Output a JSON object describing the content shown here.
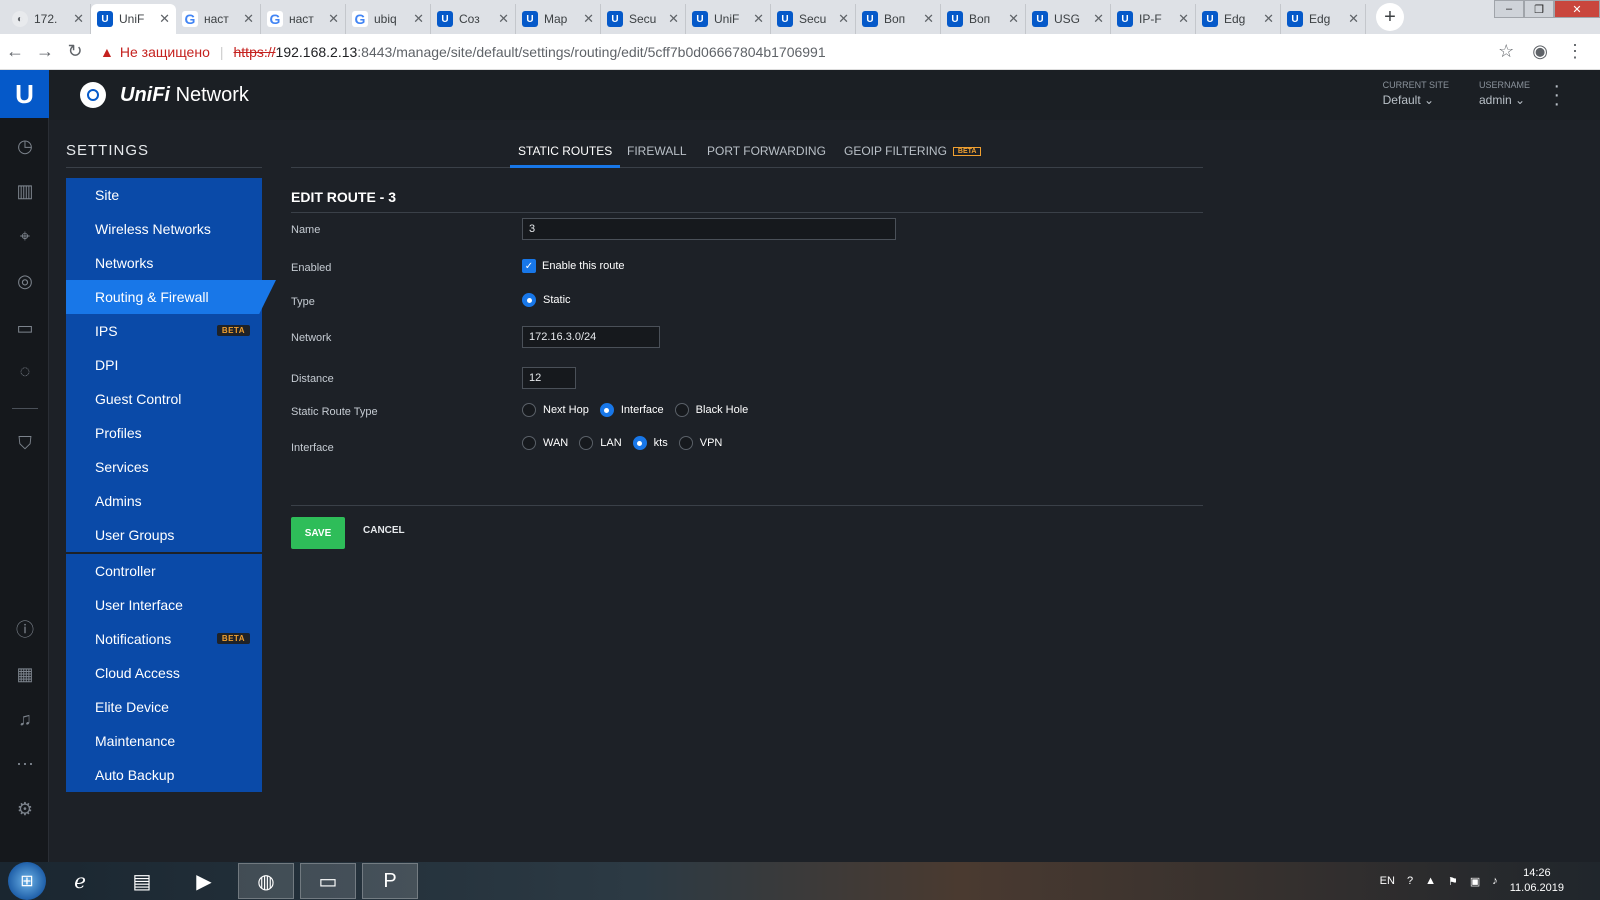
{
  "browser": {
    "tabs": [
      {
        "title": "172.",
        "icon": "w"
      },
      {
        "title": "UniF",
        "icon": "u",
        "active": true
      },
      {
        "title": "наст",
        "icon": "g"
      },
      {
        "title": "наст",
        "icon": "g"
      },
      {
        "title": "ubiq",
        "icon": "g"
      },
      {
        "title": "Соз",
        "icon": "u"
      },
      {
        "title": "Map",
        "icon": "u"
      },
      {
        "title": "Secu",
        "icon": "u"
      },
      {
        "title": "UniF",
        "icon": "u"
      },
      {
        "title": "Secu",
        "icon": "u"
      },
      {
        "title": "Воп",
        "icon": "u"
      },
      {
        "title": "Воп",
        "icon": "u"
      },
      {
        "title": "USG",
        "icon": "u"
      },
      {
        "title": "IP-F",
        "icon": "u"
      },
      {
        "title": "Edg",
        "icon": "u"
      },
      {
        "title": "Edg",
        "icon": "u"
      }
    ],
    "insecure_label": "Не защищено",
    "url_scheme": "https://",
    "url_host": "192.168.2.13",
    "url_path": ":8443/manage/site/default/settings/routing/edit/5cff7b0d06667804b1706991"
  },
  "header": {
    "brand_unifi": "UniFi",
    "brand_network": "Network",
    "current_site_label": "CURRENT SITE",
    "current_site_value": "Default",
    "username_label": "USERNAME",
    "username_value": "admin"
  },
  "sidebar": {
    "title": "SETTINGS",
    "group1": [
      {
        "label": "Site"
      },
      {
        "label": "Wireless Networks"
      },
      {
        "label": "Networks"
      },
      {
        "label": "Routing & Firewall",
        "active": true
      },
      {
        "label": "IPS",
        "badge": "BETA"
      },
      {
        "label": "DPI"
      },
      {
        "label": "Guest Control"
      },
      {
        "label": "Profiles"
      },
      {
        "label": "Services"
      },
      {
        "label": "Admins"
      },
      {
        "label": "User Groups"
      }
    ],
    "group2": [
      {
        "label": "Controller"
      },
      {
        "label": "User Interface"
      },
      {
        "label": "Notifications",
        "badge": "BETA"
      },
      {
        "label": "Cloud Access"
      },
      {
        "label": "Elite Device"
      },
      {
        "label": "Maintenance"
      },
      {
        "label": "Auto Backup"
      }
    ]
  },
  "content": {
    "tabs": {
      "static_routes": "STATIC ROUTES",
      "firewall": "FIREWALL",
      "port_forwarding": "PORT FORWARDING",
      "geoip": "GEOIP FILTERING",
      "geoip_badge": "BETA"
    },
    "section_title": "EDIT ROUTE - 3",
    "form": {
      "name_label": "Name",
      "name_value": "3",
      "enabled_label": "Enabled",
      "enabled_text": "Enable this route",
      "type_label": "Type",
      "type_static": "Static",
      "network_label": "Network",
      "network_value": "172.16.3.0/24",
      "distance_label": "Distance",
      "distance_value": "12",
      "route_type_label": "Static Route Type",
      "route_type_next_hop": "Next Hop",
      "route_type_interface": "Interface",
      "route_type_black_hole": "Black Hole",
      "interface_label": "Interface",
      "iface_wan": "WAN",
      "iface_lan": "LAN",
      "iface_kts": "kts",
      "iface_vpn": "VPN"
    },
    "save_label": "SAVE",
    "cancel_label": "CANCEL"
  },
  "taskbar": {
    "lang": "EN",
    "time": "14:26",
    "date": "11.06.2019"
  }
}
